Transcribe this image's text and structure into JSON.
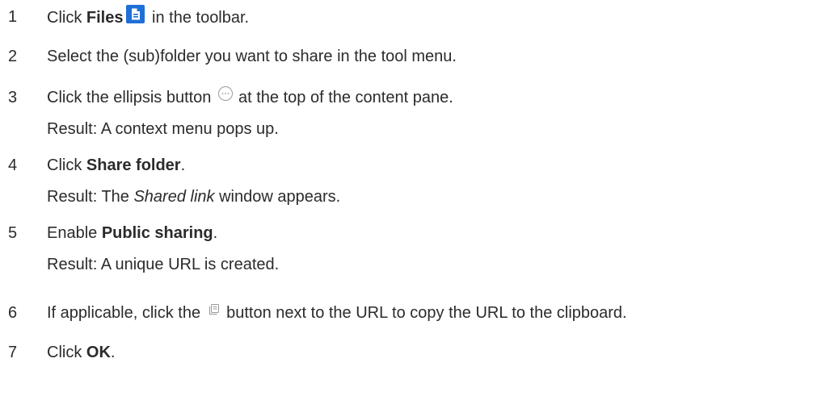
{
  "steps": [
    {
      "number": "1",
      "pre": "Click ",
      "bold": "Files",
      "icon": "files-icon",
      "post": " in the toolbar."
    },
    {
      "number": "2",
      "text": "Select the (sub)folder you want to share in the tool menu."
    },
    {
      "number": "3",
      "pre": "Click the ellipsis button",
      "icon": "ellipsis-icon",
      "post": "at the top of the content pane.",
      "result": "Result: A context menu pops up."
    },
    {
      "number": "4",
      "pre": "Click ",
      "bold": "Share folder",
      "post": ".",
      "result_pre": "Result: The ",
      "result_italic": "Shared link",
      "result_post": " window appears."
    },
    {
      "number": "5",
      "pre": "Enable ",
      "bold": "Public sharing",
      "post": ".",
      "result": "Result: A unique URL is created."
    },
    {
      "number": "6",
      "pre": "If applicable, click the",
      "icon": "copy-icon",
      "post": "button next to the URL to copy the URL to the clipboard."
    },
    {
      "number": "7",
      "pre": "Click ",
      "bold": "OK",
      "post": "."
    }
  ],
  "colors": {
    "text": "#2b2b2b",
    "files_icon": "#1e6fd6",
    "icon_outline": "#9a9a9a"
  }
}
